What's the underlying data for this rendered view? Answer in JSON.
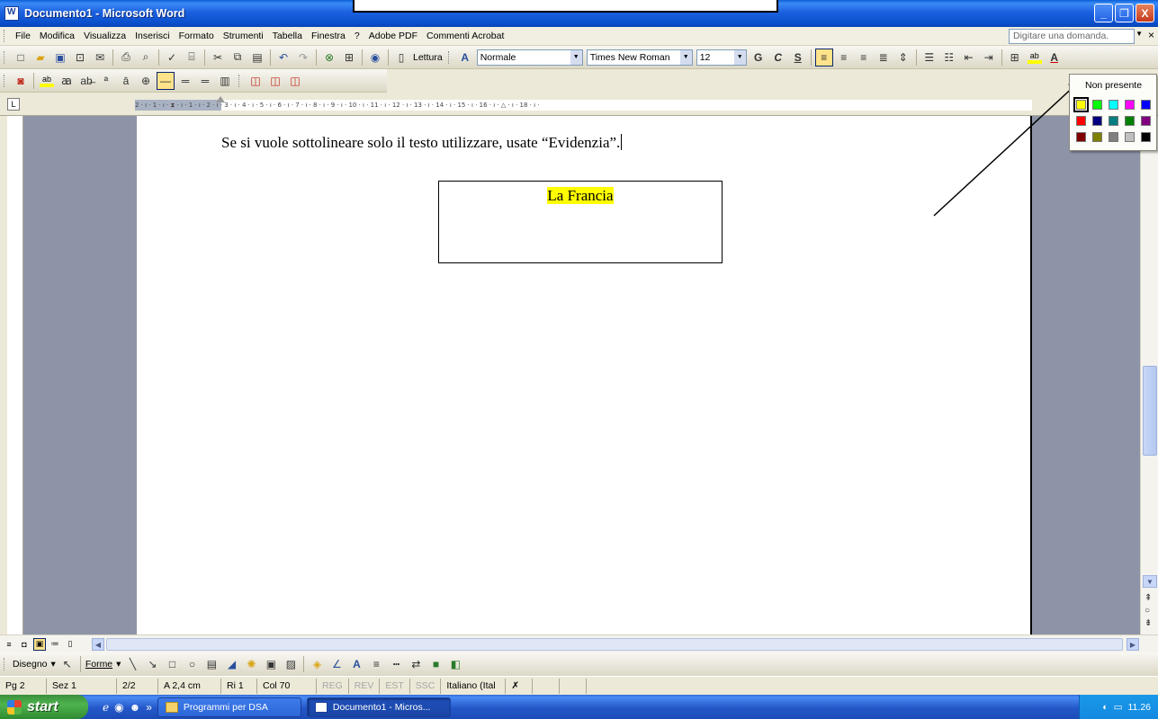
{
  "window": {
    "title": "Documento1 - Microsoft Word",
    "controls": [
      "_",
      "❐",
      "X"
    ]
  },
  "menu": {
    "items": [
      "File",
      "Modifica",
      "Visualizza",
      "Inserisci",
      "Formato",
      "Strumenti",
      "Tabella",
      "Finestra",
      "?",
      "Adobe PDF",
      "Commenti Acrobat"
    ],
    "ask_placeholder": "Digitare una domanda.",
    "close": "×"
  },
  "toolbar": {
    "read_label": "Lettura",
    "style": "Normale",
    "font": "Times New Roman",
    "size": "12",
    "bold": "G",
    "italic": "C",
    "underline": "S",
    "highlight_label": "ab",
    "font_color_label": "A"
  },
  "highlight_menu": {
    "none_label": "Non presente",
    "colors": [
      "#ffff00",
      "#00ff00",
      "#00ffff",
      "#ff00ff",
      "#0000ff",
      "#ff0000",
      "#000080",
      "#008080",
      "#008000",
      "#800080",
      "#800000",
      "#808000",
      "#808080",
      "#c0c0c0",
      "#000000"
    ],
    "selected": "#ffff00"
  },
  "ruler": {
    "ticks": "2 · ı · 1 · ı · ⧗ · ı · 1 · ı · 2 · ı · 3 · ı · 4 · ı · 5 · ı · 6 · ı · 7 · ı · 8 · ı · 9 · ı · 10 · ı · 11 · ı · 12 · ı · 13 · ı · 14 · ı · 15 · ı · 16 · ı · △ · ı · 18 · ı ·"
  },
  "document": {
    "line1": "Se si vuole sottolineare solo il testo utilizzare, usate “Evidenzia”.",
    "textbox_text": "La Francia",
    "highlight_color": "#ffff00"
  },
  "drawbar": {
    "draw_label": "Disegno",
    "shapes_label": "Forme"
  },
  "status": {
    "page": "Pg 2",
    "section": "Sez 1",
    "pages": "2/2",
    "position": "A 2,4 cm",
    "line": "Ri 1",
    "col": "Col 70",
    "reg": "REG",
    "rev": "REV",
    "est": "EST",
    "ssc": "SSC",
    "language": "Italiano (Ital"
  },
  "taskbar": {
    "start": "start",
    "tasks": [
      "Programmi per DSA",
      "Documento1 - Micros..."
    ],
    "clock": "11.26"
  },
  "colors": {
    "titlebar": "#0a4fcc",
    "docbg": "#8e94a8",
    "highlight": "#ffff00"
  }
}
